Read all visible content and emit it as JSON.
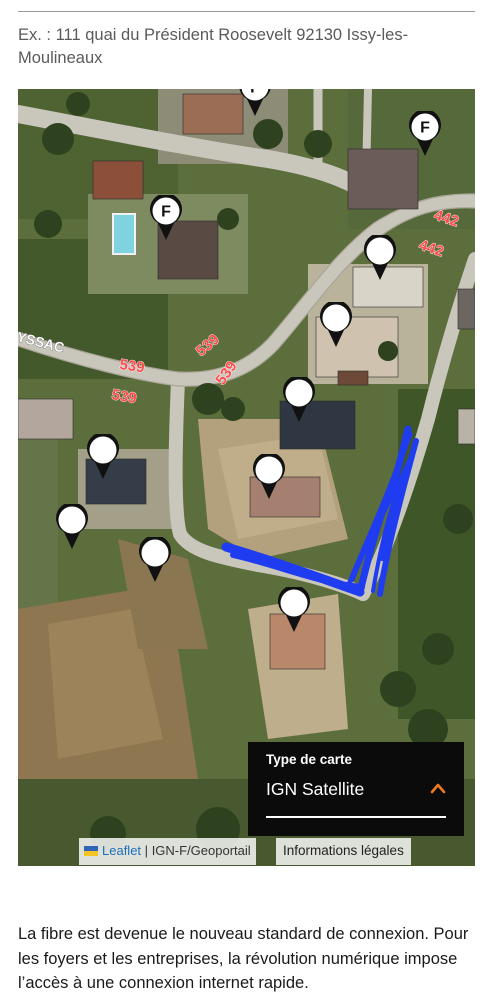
{
  "address_hint": "Ex. : 111 quai du Président Roosevelt 92130 Issy-les-Moulineaux",
  "map": {
    "road_labels": [
      "539",
      "539",
      "539",
      "539",
      "442",
      "442",
      "YSSAC"
    ],
    "pin_letter": "F",
    "pin_count": 12,
    "labeled_pin_count": 3,
    "drawing_color": "#1f3cf0",
    "layer_control": {
      "title": "Type de carte",
      "selected": "IGN Satellite",
      "icon": "chevron-up-icon",
      "accent": "#f07a22"
    },
    "attribution": {
      "leaflet": "Leaflet",
      "separator": "|",
      "provider": "IGN-F/Geoportail",
      "legal": "Informations légales"
    }
  },
  "paragraph": "La fibre est devenue le nouveau standard de connexion. Pour les foyers et les entreprises, la révolution numérique impose l’accès à une connexion internet rapide."
}
